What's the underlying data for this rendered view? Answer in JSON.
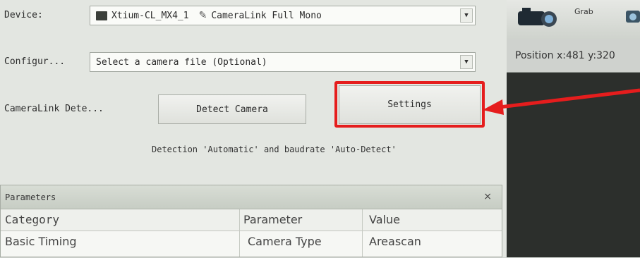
{
  "device": {
    "label": "Device:",
    "board": "Xtium-CL_MX4_1",
    "config": "CameraLink Full Mono"
  },
  "config_file": {
    "label": "Configur...",
    "value": "Select a camera file (Optional)"
  },
  "detection": {
    "label": "CameraLink Dete...",
    "detect_button": "Detect Camera",
    "settings_button": "Settings",
    "note": "Detection 'Automatic' and baudrate 'Auto-Detect'"
  },
  "parameters": {
    "title": "Parameters",
    "close": "×",
    "columns": [
      "Category",
      "Parameter",
      "Value"
    ],
    "rows": [
      {
        "category": "Basic Timing",
        "parameter": "Camera Type",
        "value": "Areascan"
      }
    ]
  },
  "toolbar": {
    "grab_label": "Grab"
  },
  "status": {
    "position": "Position x:481 y:320"
  },
  "annotation": {
    "highlight_color": "#e51d1d"
  }
}
